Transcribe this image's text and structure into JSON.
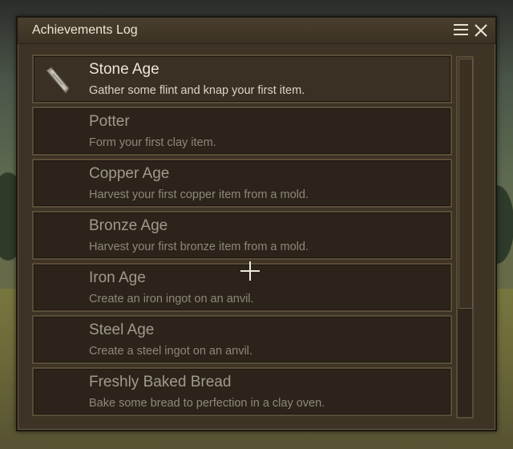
{
  "window": {
    "title": "Achievements Log",
    "menu_icon": "hamburger-menu-icon",
    "close_icon": "close-icon"
  },
  "achievements": [
    {
      "name": "Stone Age",
      "description": "Gather some flint and knap your first item.",
      "unlocked": true,
      "icon": "flint-knife-icon"
    },
    {
      "name": "Potter",
      "description": "Form your first clay item.",
      "unlocked": false
    },
    {
      "name": "Copper Age",
      "description": "Harvest your first copper item from a mold.",
      "unlocked": false
    },
    {
      "name": "Bronze Age",
      "description": "Harvest your first bronze item from a mold.",
      "unlocked": false
    },
    {
      "name": "Iron Age",
      "description": "Create an iron ingot on an anvil.",
      "unlocked": false
    },
    {
      "name": "Steel Age",
      "description": "Create a steel ingot on an anvil.",
      "unlocked": false
    },
    {
      "name": "Freshly Baked Bread",
      "description": "Bake some bread to perfection in a clay oven.",
      "unlocked": false
    }
  ],
  "colors": {
    "panel": "#3d3426",
    "unlocked_text": "#ece6d8",
    "locked_text": "#a19a8c"
  }
}
